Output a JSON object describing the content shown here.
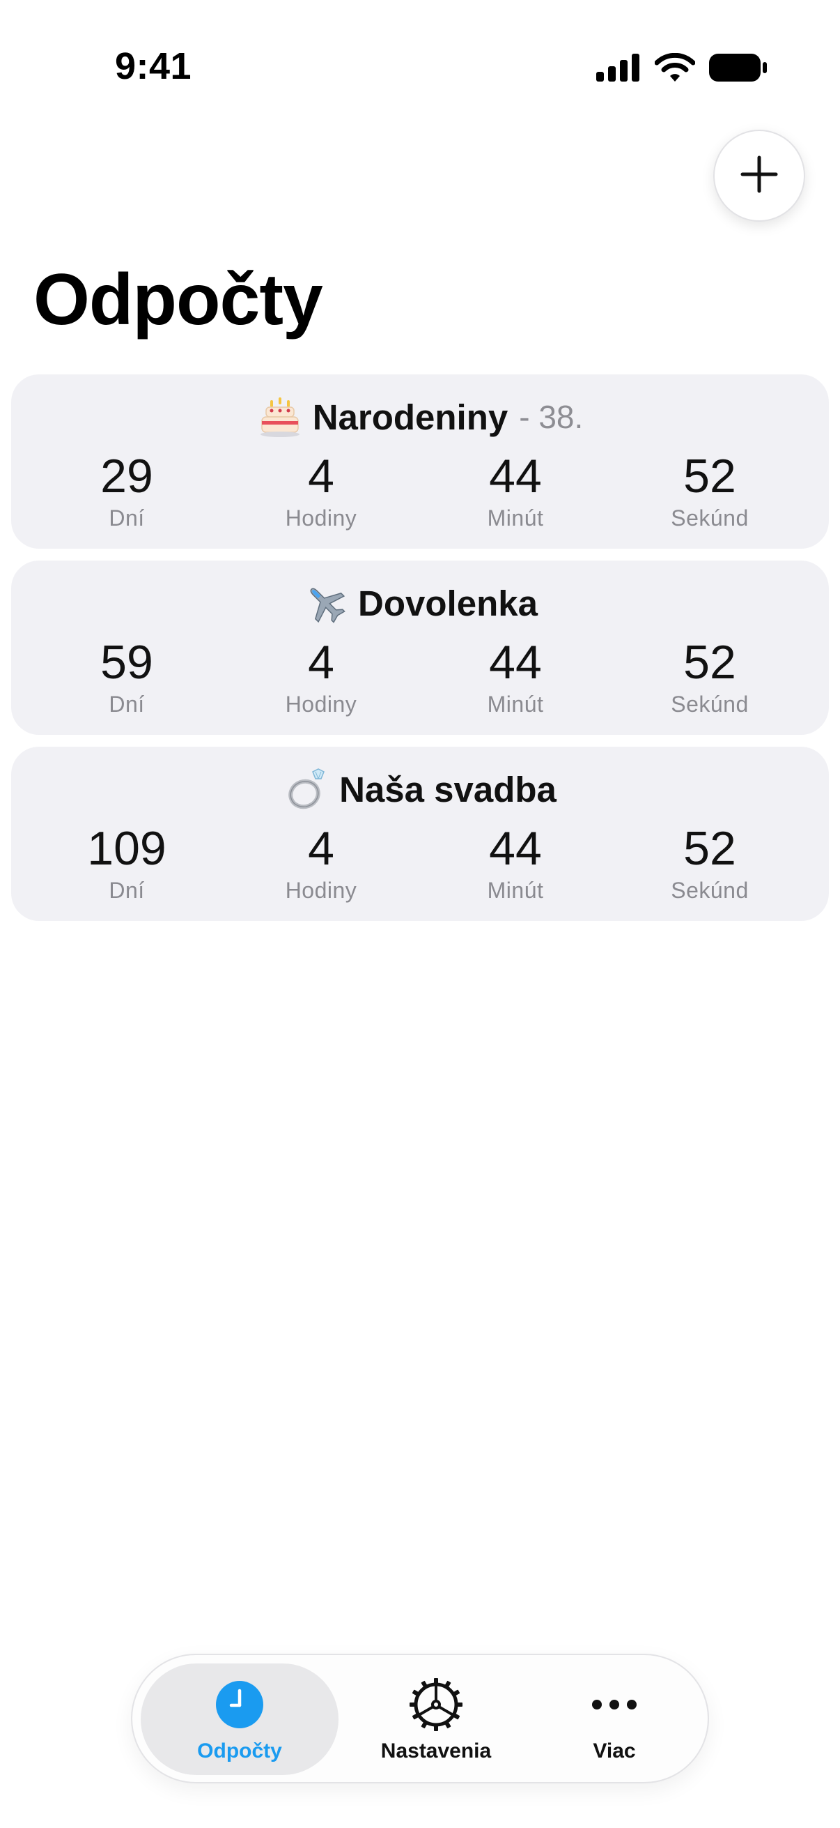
{
  "status_bar": {
    "time": "9:41",
    "icons": [
      "cellular-signal-icon",
      "wifi-icon",
      "battery-icon"
    ]
  },
  "header": {
    "add_icon": "plus-icon",
    "title": "Odpočty"
  },
  "countdowns": [
    {
      "emoji": "birthday-cake-icon",
      "name": "Narodeniny",
      "suffix": "- 38.",
      "units": [
        {
          "value": "29",
          "label": "Dní"
        },
        {
          "value": "4",
          "label": "Hodiny"
        },
        {
          "value": "44",
          "label": "Minút"
        },
        {
          "value": "52",
          "label": "Sekúnd"
        }
      ]
    },
    {
      "emoji": "airplane-icon",
      "name": "Dovolenka",
      "suffix": "",
      "units": [
        {
          "value": "59",
          "label": "Dní"
        },
        {
          "value": "4",
          "label": "Hodiny"
        },
        {
          "value": "44",
          "label": "Minút"
        },
        {
          "value": "52",
          "label": "Sekúnd"
        }
      ]
    },
    {
      "emoji": "ring-icon",
      "name": "Naša svadba",
      "suffix": "",
      "units": [
        {
          "value": "109",
          "label": "Dní"
        },
        {
          "value": "4",
          "label": "Hodiny"
        },
        {
          "value": "44",
          "label": "Minút"
        },
        {
          "value": "52",
          "label": "Sekúnd"
        }
      ]
    }
  ],
  "tab_bar": {
    "tabs": [
      {
        "label": "Odpočty",
        "icon": "clock-icon",
        "active": true
      },
      {
        "label": "Nastavenia",
        "icon": "gear-icon",
        "active": false
      },
      {
        "label": "Viac",
        "icon": "more-icon",
        "active": false
      }
    ]
  },
  "colors": {
    "accent": "#1a9bf0",
    "card_background": "#f1f1f5",
    "secondary_text": "#8a8a90"
  }
}
